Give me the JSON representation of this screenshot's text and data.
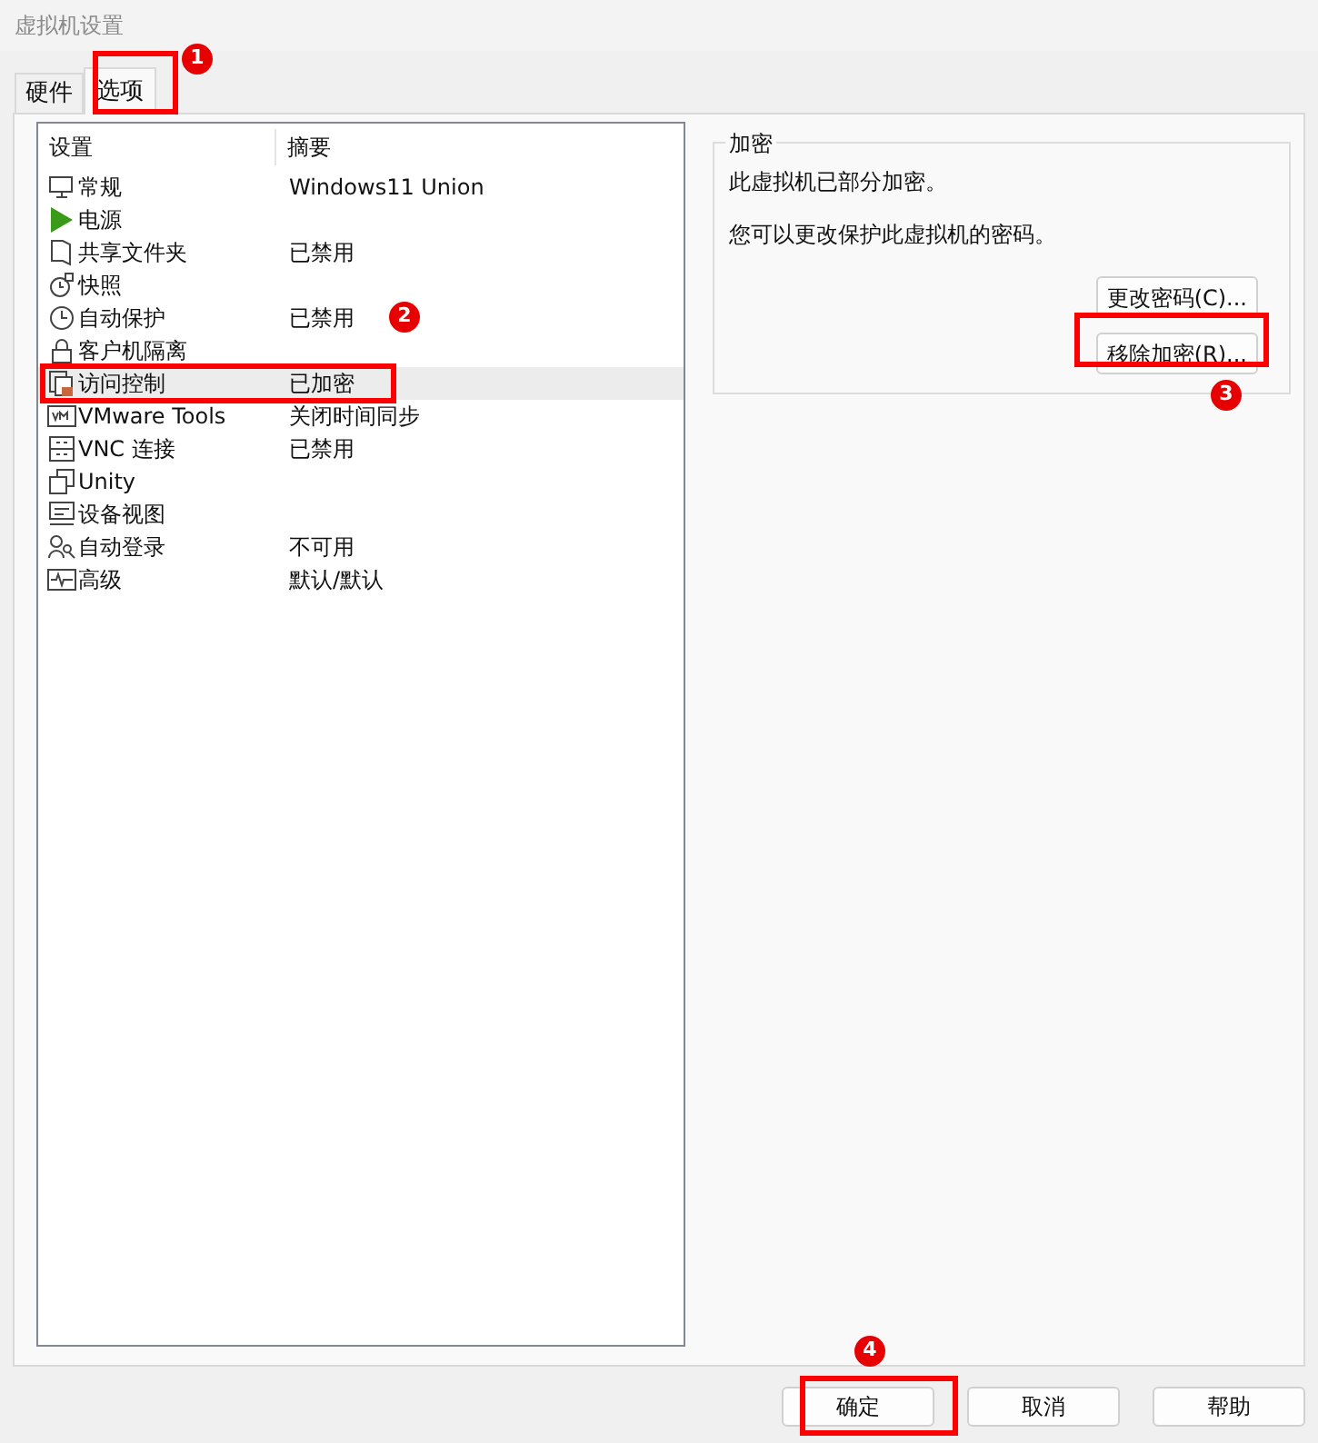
{
  "window": {
    "title": "虚拟机设置"
  },
  "tabs": [
    {
      "label": "硬件",
      "selected": false
    },
    {
      "label": "选项",
      "selected": true
    }
  ],
  "settings_list": {
    "columns": [
      "设置",
      "摘要"
    ],
    "rows": [
      {
        "name": "常规",
        "summary": "Windows11 Union",
        "selected": false
      },
      {
        "name": "电源",
        "summary": "",
        "selected": false
      },
      {
        "name": "共享文件夹",
        "summary": "已禁用",
        "selected": false
      },
      {
        "name": "快照",
        "summary": "",
        "selected": false
      },
      {
        "name": "自动保护",
        "summary": "已禁用",
        "selected": false
      },
      {
        "name": "客户机隔离",
        "summary": "",
        "selected": false
      },
      {
        "name": "访问控制",
        "summary": "已加密",
        "selected": true
      },
      {
        "name": "VMware Tools",
        "summary": "关闭时间同步",
        "selected": false
      },
      {
        "name": "VNC 连接",
        "summary": "已禁用",
        "selected": false
      },
      {
        "name": "Unity",
        "summary": "",
        "selected": false
      },
      {
        "name": "设备视图",
        "summary": "",
        "selected": false
      },
      {
        "name": "自动登录",
        "summary": "不可用",
        "selected": false
      },
      {
        "name": "高级",
        "summary": "默认/默认",
        "selected": false
      }
    ]
  },
  "encryption": {
    "title": "加密",
    "lines": [
      "此虚拟机已部分加密。",
      "您可以更改保护此虚拟机的密码。"
    ],
    "buttons": [
      "更改密码(C)...",
      "移除加密(R)..."
    ]
  },
  "buttons": [
    "确定",
    "取消",
    "帮助"
  ],
  "annotations": [
    {
      "number": "1"
    },
    {
      "number": "2"
    },
    {
      "number": "3"
    },
    {
      "number": "4"
    }
  ]
}
